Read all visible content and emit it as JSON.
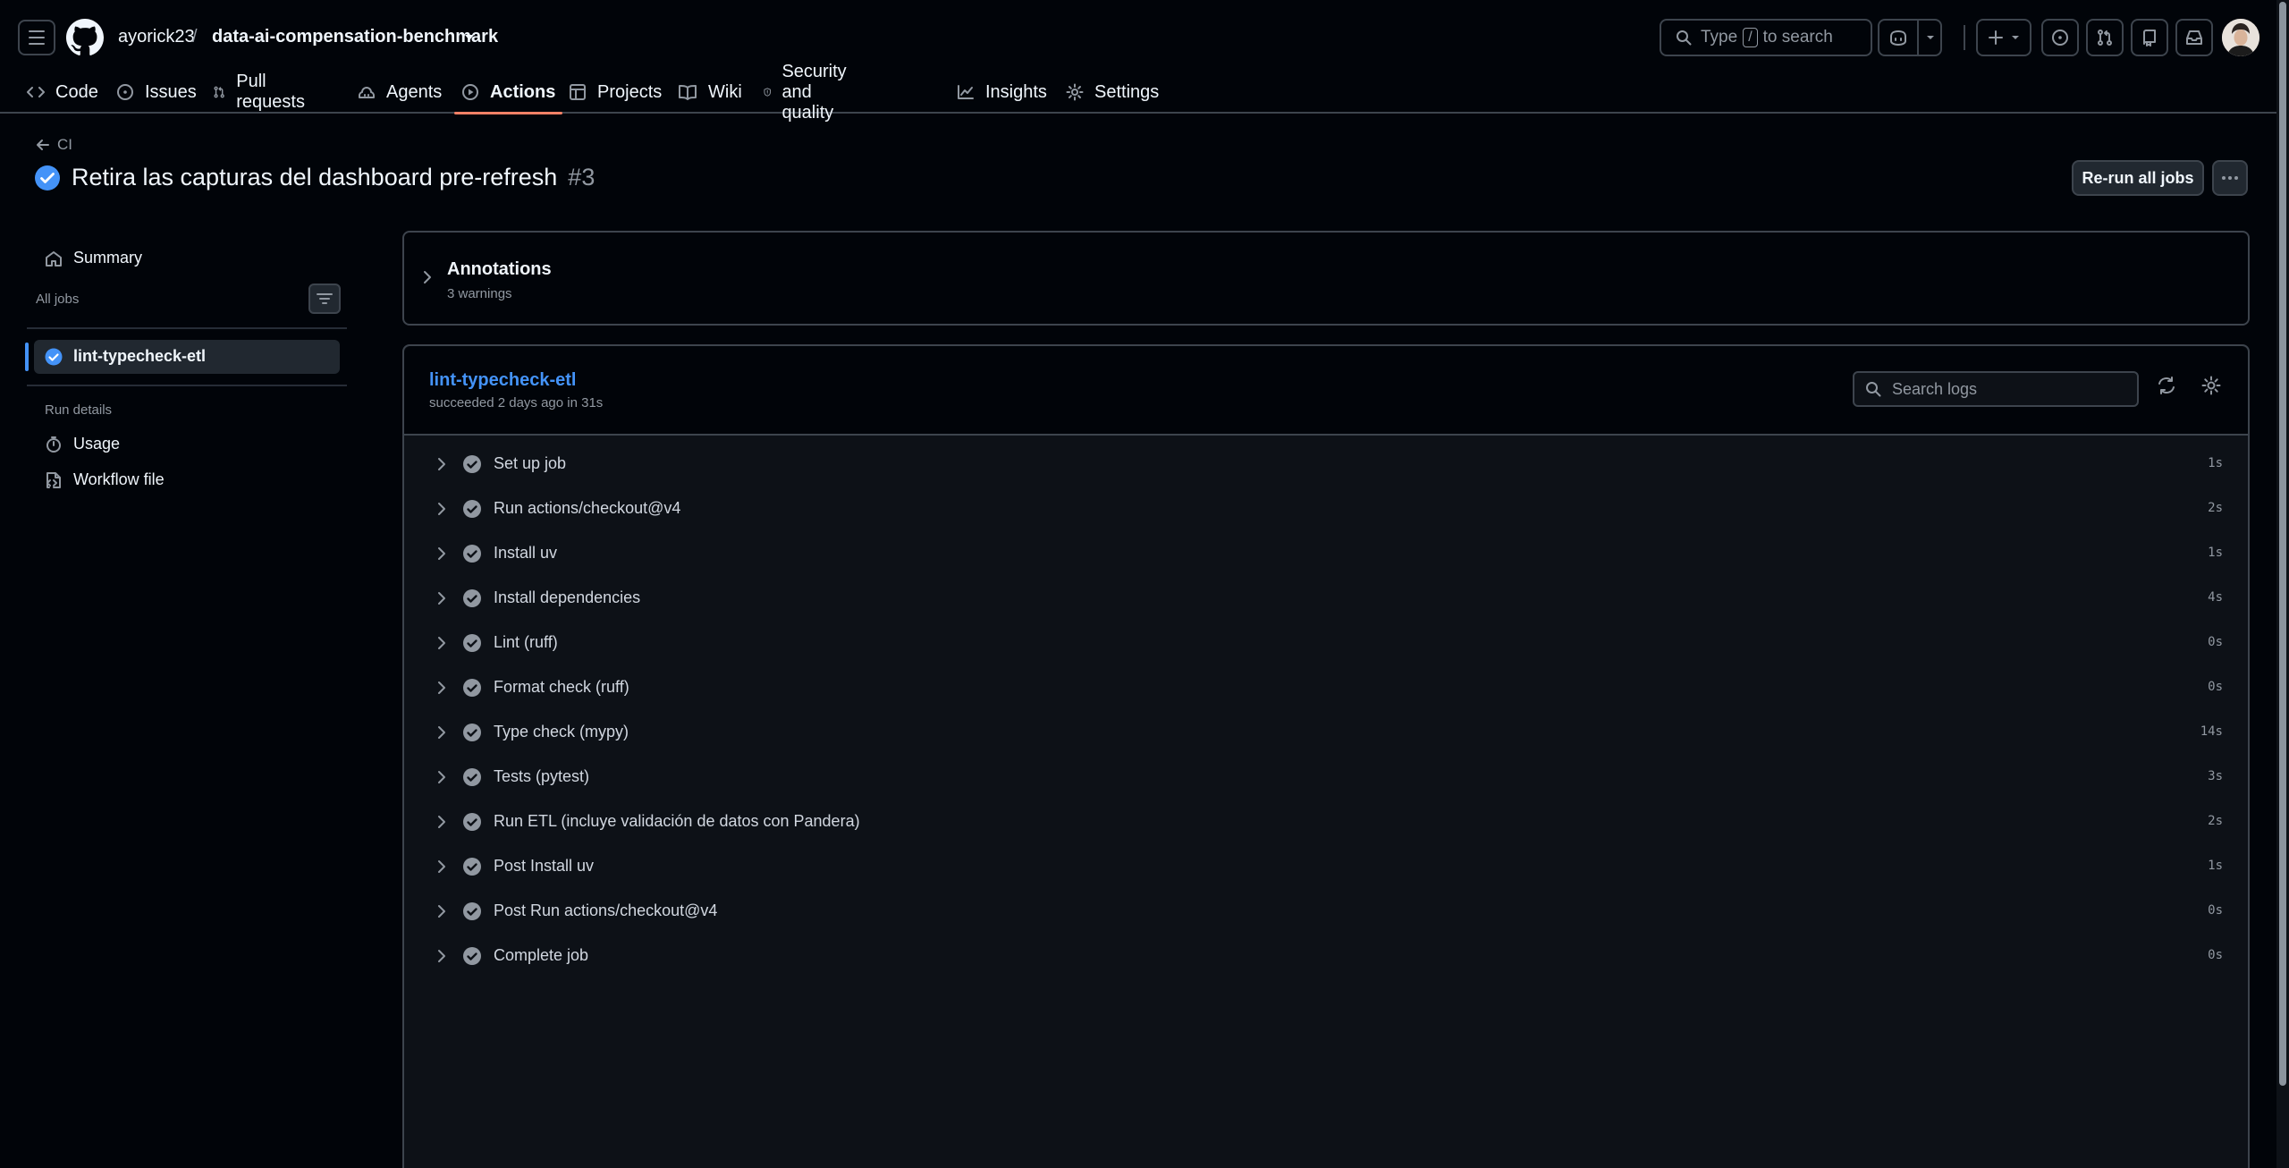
{
  "repo": {
    "owner": "ayorick23",
    "separator": "/",
    "name": "data-ai-compensation-benchmark"
  },
  "search": {
    "prefix": "Type",
    "key": "/",
    "suffix": "to search"
  },
  "tabs": [
    {
      "label": "Code",
      "icon": "code-icon"
    },
    {
      "label": "Issues",
      "icon": "issue-opened-icon"
    },
    {
      "label": "Pull requests",
      "icon": "git-pull-request-icon"
    },
    {
      "label": "Agents",
      "icon": "agent-icon"
    },
    {
      "label": "Actions",
      "icon": "play-icon",
      "active": true
    },
    {
      "label": "Projects",
      "icon": "table-icon"
    },
    {
      "label": "Wiki",
      "icon": "book-icon"
    },
    {
      "label": "Security and quality",
      "icon": "shield-icon"
    },
    {
      "label": "Insights",
      "icon": "graph-icon"
    },
    {
      "label": "Settings",
      "icon": "gear-icon"
    }
  ],
  "run": {
    "back_label": "CI",
    "title": "Retira las capturas del dashboard pre-refresh",
    "number": "#3",
    "rerun_label": "Re-run all jobs",
    "status": "success"
  },
  "sidebar": {
    "summary": "Summary",
    "all_jobs": "All jobs",
    "selected_job": "lint-typecheck-etl",
    "run_details": "Run details",
    "usage": "Usage",
    "workflow_file": "Workflow file"
  },
  "annotations": {
    "title": "Annotations",
    "subtitle": "3 warnings"
  },
  "job": {
    "name": "lint-typecheck-etl",
    "subtitle": "succeeded 2 days ago in 31s",
    "search_placeholder": "Search logs",
    "steps": [
      {
        "label": "Set up job",
        "duration": "1s"
      },
      {
        "label": "Run actions/checkout@v4",
        "duration": "2s"
      },
      {
        "label": "Install uv",
        "duration": "1s"
      },
      {
        "label": "Install dependencies",
        "duration": "4s"
      },
      {
        "label": "Lint (ruff)",
        "duration": "0s"
      },
      {
        "label": "Format check (ruff)",
        "duration": "0s"
      },
      {
        "label": "Type check (mypy)",
        "duration": "14s"
      },
      {
        "label": "Tests (pytest)",
        "duration": "3s"
      },
      {
        "label": "Run ETL (incluye validación de datos con Pandera)",
        "duration": "2s"
      },
      {
        "label": "Post Install uv",
        "duration": "1s"
      },
      {
        "label": "Post Run actions/checkout@v4",
        "duration": "0s"
      },
      {
        "label": "Complete job",
        "duration": "0s"
      }
    ]
  },
  "colors": {
    "accent": "#4493f8",
    "success": "#9198a1",
    "active_tab": "#f78166",
    "background": "#010409"
  }
}
